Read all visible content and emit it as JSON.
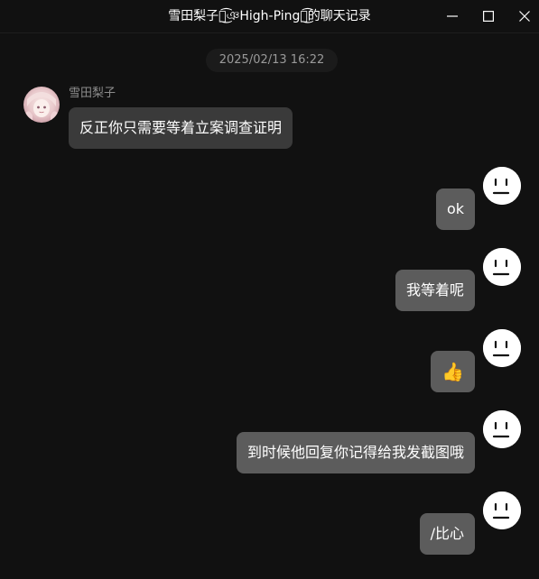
{
  "window": {
    "title": "雪田梨子和͜͡ঞHigh-Pingঞ͜͡的聊天记录"
  },
  "chat": {
    "timestamp": "2025/02/13 16:22",
    "contact": {
      "name": "雪田梨子"
    },
    "messages": [
      {
        "side": "left",
        "text": "反正你只需要等着立案调查证明"
      },
      {
        "side": "right",
        "text": "ok"
      },
      {
        "side": "right",
        "text": "我等着呢"
      },
      {
        "side": "right",
        "text": "👍"
      },
      {
        "side": "right",
        "text": "到时候他回复你记得给我发截图哦"
      },
      {
        "side": "right",
        "text": "/比心"
      }
    ]
  },
  "colors": {
    "background": "#111111",
    "bubble_self": "#5c5c5c",
    "bubble_other": "#3a3a3a",
    "text": "#ffffff",
    "muted": "#8c8c8c"
  },
  "icons": {
    "minimize": "minimize-icon",
    "maximize": "maximize-icon",
    "close": "close-icon",
    "self_avatar": "straight-face-avatar",
    "contact_avatar": "anime-avatar"
  }
}
